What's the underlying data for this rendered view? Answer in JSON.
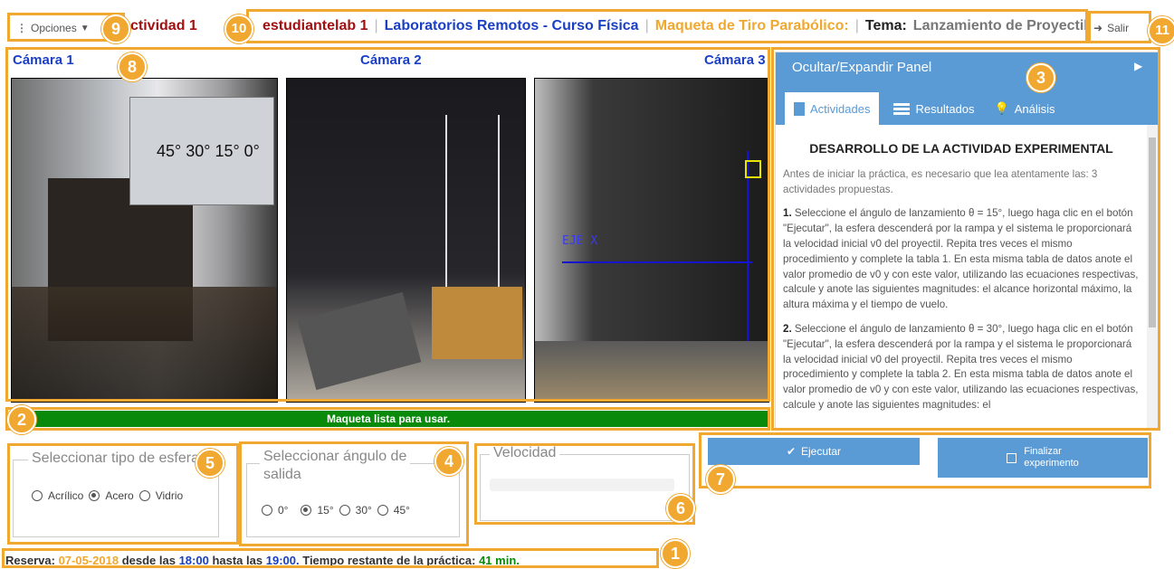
{
  "topbar": {
    "options_label": "Opciones",
    "activity": "ctividad 1",
    "user": "estudiantelab 1",
    "lab": "Laboratorios Remotos - Curso Física",
    "model": "Maqueta de Tiro Parabólico:",
    "theme_label": "Tema:",
    "theme": "Lanzamiento de Proyectil",
    "exit_label": "Salir"
  },
  "cameras": {
    "cam1": "Cámara 1",
    "cam2": "Cámara 2",
    "cam3": "Cámara 3",
    "cam1_overlay": "45° 30° 15° 0°",
    "cam3_overlay": "EJE X"
  },
  "status": {
    "message": "Maqueta lista para usar.",
    "color": "#0a8a0a"
  },
  "sphere": {
    "legend": "Seleccionar tipo de esfera",
    "options": [
      "Acrílico",
      "Acero",
      "Vidrio"
    ],
    "selected": "Acero"
  },
  "angle": {
    "legend_1": "Seleccionar ángulo de",
    "legend_2": "salida",
    "options": [
      "0°",
      "15°",
      "30°",
      "45°"
    ],
    "selected": "15°"
  },
  "speed": {
    "legend": "Velocidad"
  },
  "actions": {
    "execute": "Ejecutar",
    "finish_1": "Finalizar",
    "finish_2": "experimento"
  },
  "panel": {
    "header": "Ocultar/Expandir Panel",
    "tabs": [
      "Actividades",
      "Resultados",
      "Análisis"
    ],
    "active_tab": "Actividades",
    "title": "DESARROLLO DE LA ACTIVIDAD EXPERIMENTAL",
    "intro": "Antes de iniciar la práctica, es necesario que lea atentamente las: 3 actividades propuestas.",
    "item1_num": "1.",
    "item1": "Seleccione el ángulo de lanzamiento θ = 15°, luego haga clic en el botón \"Ejecutar\", la esfera descenderá por la rampa y el sistema le proporcionará la velocidad inicial v0 del proyectil. Repita tres veces el mismo procedimiento y complete la tabla 1. En esta misma tabla de datos anote el valor promedio de v0 y con este valor, utilizando las ecuaciones respectivas, calcule y anote las siguientes magnitudes: el alcance horizontal máximo, la altura máxima y el tiempo de vuelo.",
    "item2_num": "2.",
    "item2": "Seleccione el ángulo de lanzamiento θ = 30°, luego haga clic en el botón \"Ejecutar\", la esfera descenderá por la rampa y el sistema le proporcionará la velocidad inicial v0 del proyectil. Repita tres veces el mismo procedimiento y complete la tabla 2. En esta misma tabla de datos anote el valor promedio de v0 y con este valor, utilizando las ecuaciones respectivas, calcule y anote las siguientes magnitudes: el"
  },
  "reservation": {
    "label": "Reserva:",
    "date": "07-05-2018",
    "from_label": "desde las",
    "from": "18:00",
    "to_label": "hasta las",
    "to": "19:00.",
    "remaining_label": "Tiempo restante de la práctica:",
    "remaining": "41 min."
  },
  "badges": {
    "b1": "1",
    "b2": "2",
    "b3": "3",
    "b4": "4",
    "b5": "5",
    "b6": "6",
    "b7": "7",
    "b8": "8",
    "b9": "9",
    "b10": "10",
    "b11": "11"
  },
  "colors": {
    "accent": "#f0a830",
    "blue_link": "#1a3fc4",
    "dark_red": "#a01010",
    "panel_blue": "#5b9bd5"
  }
}
